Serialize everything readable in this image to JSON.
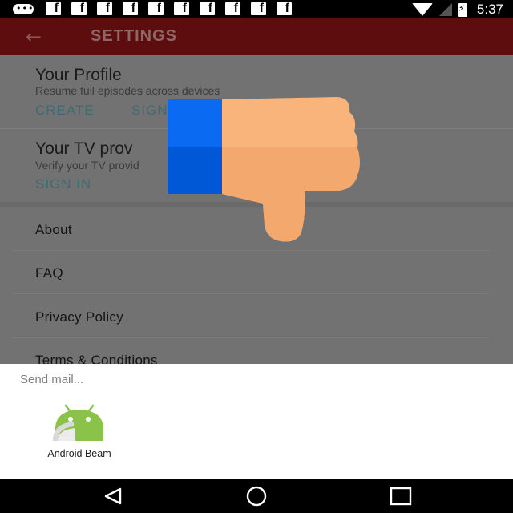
{
  "status_bar": {
    "time": "5:37",
    "notification_icons": [
      "cast-icon",
      "facebook-icon",
      "facebook-icon",
      "facebook-icon",
      "facebook-icon",
      "facebook-icon",
      "facebook-icon",
      "facebook-icon",
      "facebook-icon",
      "facebook-icon",
      "facebook-icon"
    ]
  },
  "app_bar": {
    "back_icon": "back-arrow-icon",
    "title": "SETTINGS"
  },
  "profile_section": {
    "title": "Your Profile",
    "subtitle": "Resume full episodes across devices",
    "create_label": "CREATE",
    "sign_in_label": "SIGN"
  },
  "tv_section": {
    "title": "Your TV prov",
    "subtitle": "Verify your TV provid",
    "sign_in_label": "SIGN IN"
  },
  "menu": {
    "items": [
      {
        "label": "About"
      },
      {
        "label": "FAQ"
      },
      {
        "label": "Privacy Policy"
      },
      {
        "label": "Terms & Conditions"
      }
    ]
  },
  "overlay": {
    "icon": "thumbs-down-icon",
    "colors": {
      "cuff": "#0b6af2",
      "hand": "#f9b47c"
    }
  },
  "share_sheet": {
    "title": "Send mail...",
    "apps": [
      {
        "label": "Android Beam",
        "icon": "android-beam-icon"
      }
    ]
  },
  "nav_bar": {
    "back": "nav-back-icon",
    "home": "nav-home-icon",
    "recents": "nav-recents-icon"
  },
  "colors": {
    "app_bar": "#5e0d0f",
    "accent_link": "#3e6b73",
    "android_green": "#8bc34a"
  }
}
